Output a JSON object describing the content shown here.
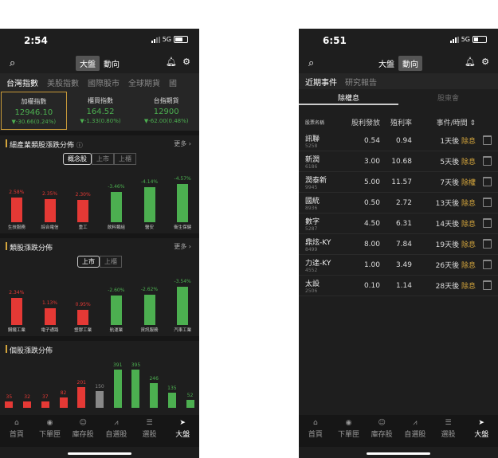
{
  "colors": {
    "up": "#e53935",
    "down": "#4caf50",
    "accent": "#d4a53c"
  },
  "left": {
    "status": {
      "time": "2:54",
      "network": "5G"
    },
    "toolbar": {
      "seg_market": "大盤",
      "seg_trend": "動向",
      "search_icon": "search-icon",
      "bell_icon": "bell-icon",
      "gear_icon": "gear-icon"
    },
    "tabs": [
      "台灣指數",
      "美股指數",
      "國際股市",
      "全球期貨",
      "國"
    ],
    "indices": [
      {
        "name": "加權指數",
        "value": "12946.10",
        "change": "▼-30.66(0.24%)"
      },
      {
        "name": "櫃買指數",
        "value": "164.52",
        "change": "▼-1.33(0.80%)"
      },
      {
        "name": "台指期貨",
        "value": "12900",
        "change": "▼-62.00(0.48%)"
      }
    ],
    "industry": {
      "title": "細產業類股漲跌分佈",
      "info_icon": "info-icon",
      "more": "更多 ›",
      "pills": [
        "概念股",
        "上市",
        "上櫃"
      ],
      "chart_data": {
        "type": "bar",
        "categories": [
          "生技服務",
          "綜合電信",
          "重工",
          "飲料類組",
          "醫安",
          "衛生保健"
        ],
        "values": [
          2.58,
          2.35,
          2.3,
          -3.46,
          -4.14,
          -4.57
        ],
        "labels": [
          "2.58%",
          "2.35%",
          "2.30%",
          "-3.46%",
          "-4.14%",
          "-4.57%"
        ]
      }
    },
    "sector": {
      "title": "類股漲跌分佈",
      "more": "更多 ›",
      "pills": [
        "上市",
        "上櫃"
      ],
      "chart_data": {
        "type": "bar",
        "categories": [
          "鋼鐵工業",
          "電子通路",
          "塑膠工業",
          "航運業",
          "資訊服務",
          "汽車工業"
        ],
        "values": [
          2.34,
          1.13,
          0.95,
          -2.6,
          -2.62,
          -3.54
        ],
        "labels": [
          "2.34%",
          "1.13%",
          "0.95%",
          "-2.60%",
          "-2.62%",
          "-3.54%"
        ]
      }
    },
    "stock": {
      "title": "個股漲跌分佈",
      "chart_data": {
        "type": "bar",
        "values": [
          35,
          32,
          37,
          82,
          201,
          150,
          391,
          395,
          246,
          135,
          52
        ],
        "labels": [
          "35",
          "32",
          "37",
          "82",
          "201",
          "150",
          "391",
          "395",
          "246",
          "135",
          "52"
        ],
        "colors": [
          "up",
          "up",
          "up",
          "up",
          "up",
          "neutral",
          "down",
          "down",
          "down",
          "down",
          "down"
        ]
      }
    },
    "nav": [
      {
        "icon": "home-icon",
        "glyph": "⌂",
        "label": "首頁"
      },
      {
        "icon": "record-icon",
        "glyph": "◉",
        "label": "下單匣"
      },
      {
        "icon": "person-icon",
        "glyph": "☺",
        "label": "庫存股"
      },
      {
        "icon": "chart-icon",
        "glyph": "⩘",
        "label": "自選股"
      },
      {
        "icon": "stack-icon",
        "glyph": "☰",
        "label": "選股"
      },
      {
        "icon": "arrow-icon",
        "glyph": "➤",
        "label": "大盤"
      }
    ]
  },
  "right": {
    "status": {
      "time": "6:51",
      "network": "5G"
    },
    "toolbar": {
      "seg_market": "大盤",
      "seg_trend": "動向"
    },
    "subtabs": [
      "近期事件",
      "研究報告"
    ],
    "event_tabs": [
      "除權息",
      "股東會"
    ],
    "headers": [
      "股票名稱",
      "股利發放",
      "殖利率",
      "事件/時間 ⇕"
    ],
    "rows": [
      {
        "name": "訊聯",
        "code": "5258",
        "div": "0.54",
        "yield": "0.94",
        "days": "1天後",
        "kind": "除息"
      },
      {
        "name": "新潤",
        "code": "6186",
        "div": "3.00",
        "yield": "10.68",
        "days": "5天後",
        "kind": "除息"
      },
      {
        "name": "潤泰新",
        "code": "9945",
        "div": "5.00",
        "yield": "11.57",
        "days": "7天後",
        "kind": "除權"
      },
      {
        "name": "國統",
        "code": "8936",
        "div": "0.50",
        "yield": "2.72",
        "days": "13天後",
        "kind": "除息"
      },
      {
        "name": "數字",
        "code": "5287",
        "div": "4.50",
        "yield": "6.31",
        "days": "14天後",
        "kind": "除息"
      },
      {
        "name": "鼎炫-KY",
        "code": "8499",
        "div": "8.00",
        "yield": "7.84",
        "days": "19天後",
        "kind": "除息"
      },
      {
        "name": "力達-KY",
        "code": "4552",
        "div": "1.00",
        "yield": "3.49",
        "days": "26天後",
        "kind": "除息"
      },
      {
        "name": "太設",
        "code": "2506",
        "div": "0.10",
        "yield": "1.14",
        "days": "28天後",
        "kind": "除息"
      }
    ]
  }
}
